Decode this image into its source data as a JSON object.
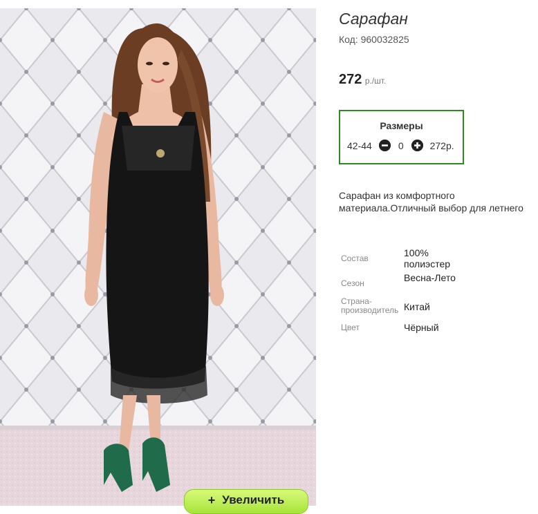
{
  "product": {
    "title": "Сарафан",
    "sku": "Код: 960032825",
    "price": "272",
    "price_unit": "р./шт.",
    "description": "Сарафан из комфортного материала.Отличный выбор для летнего гардероба."
  },
  "sizes": {
    "title": "Размеры",
    "rows": [
      {
        "size": "42-44",
        "quantity": "0",
        "price": "272р."
      }
    ]
  },
  "specs": [
    {
      "label": "Состав",
      "value": "100% полиэстер"
    },
    {
      "label": "Сезон",
      "value": "Весна-Лето"
    },
    {
      "label": "Страна-производитель",
      "value": "Китай"
    },
    {
      "label": "Цвет",
      "value": "Чёрный"
    }
  ],
  "zoom_button": {
    "label": "Увеличить",
    "icon": "plus-icon"
  },
  "colors": {
    "accent_border": "#2c8a1e",
    "zoom_button": "#b8ee52",
    "dress": "#151515",
    "shoes": "#1f6b4a"
  }
}
